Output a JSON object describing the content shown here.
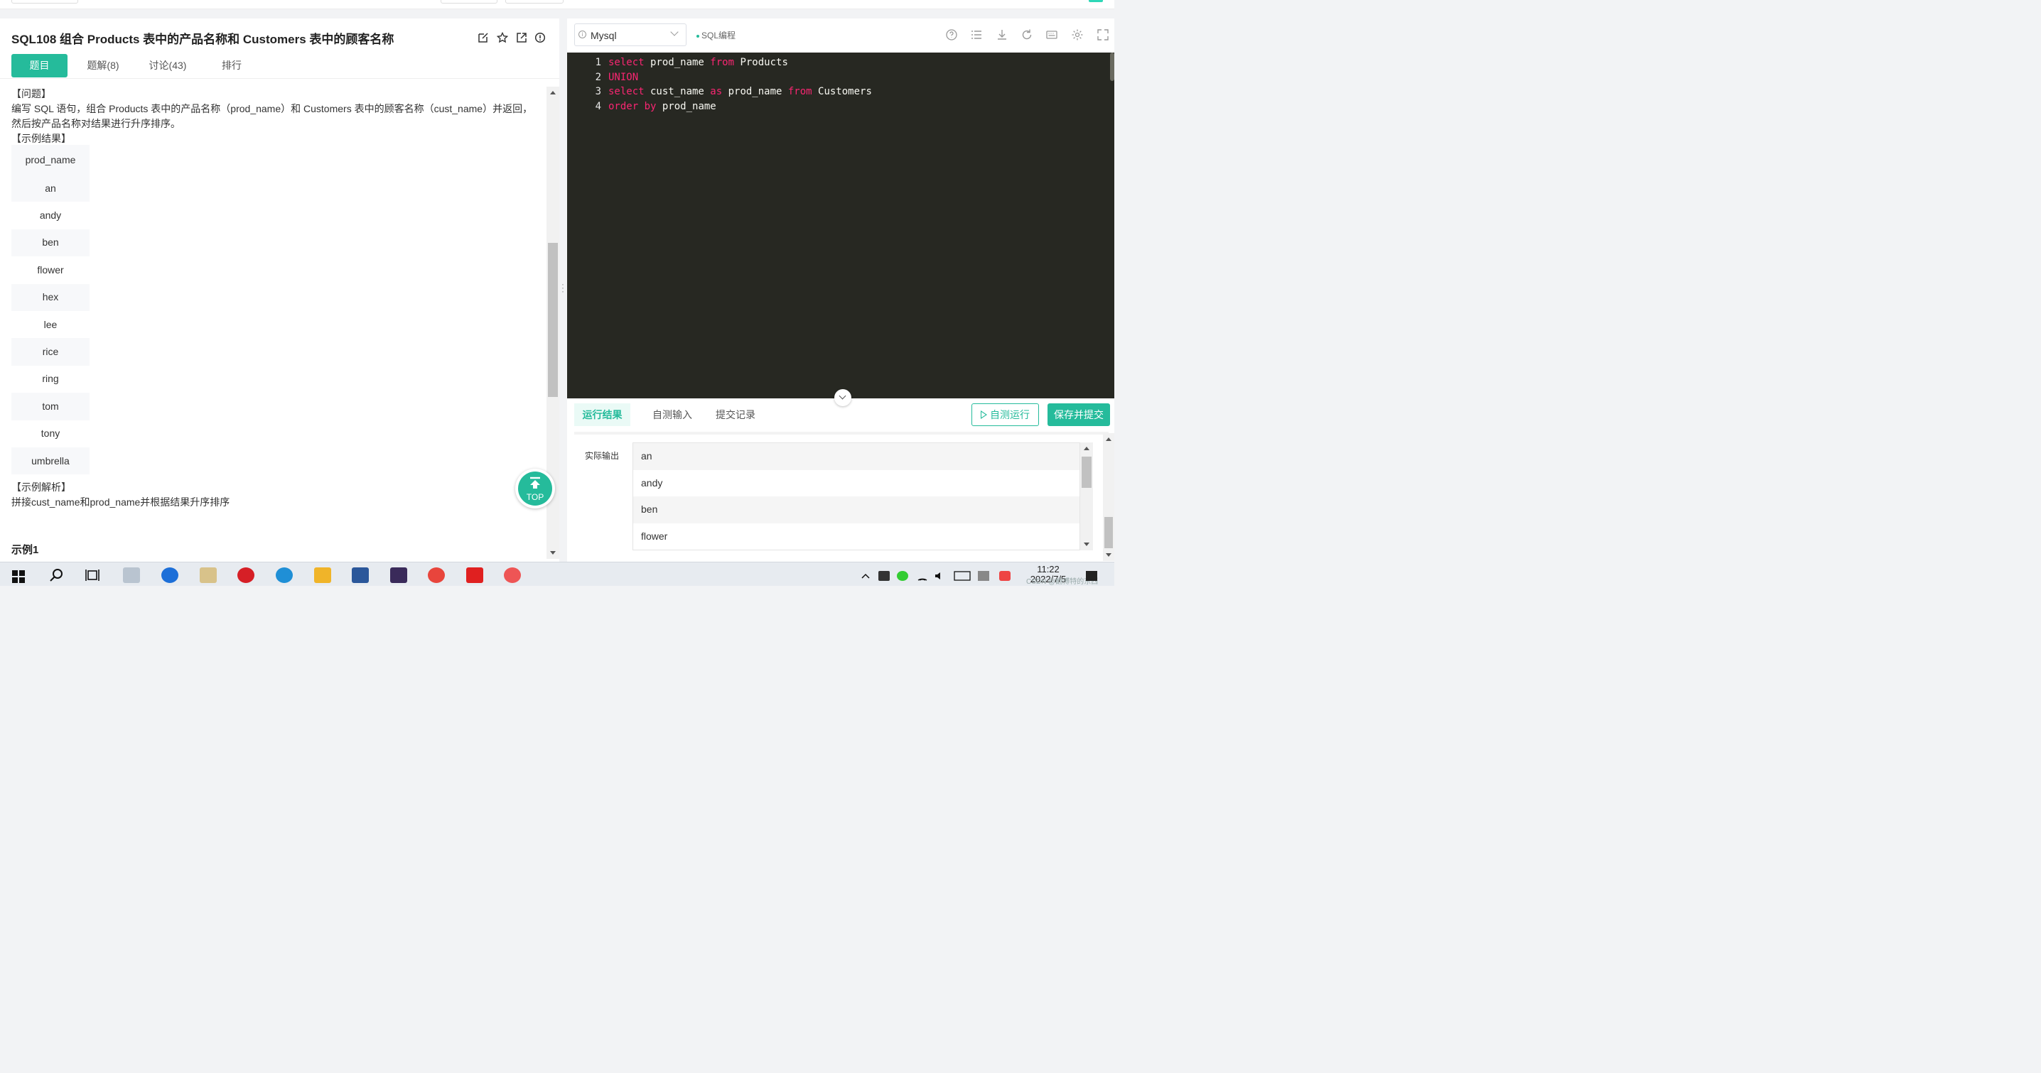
{
  "question": {
    "title": "SQL108  组合 Products 表中的产品名称和 Customers 表中的顾客名称",
    "tabs": [
      "题目",
      "题解(8)",
      "讨论(43)",
      "排行"
    ],
    "section_problem": "【问题】",
    "description": "编写 SQL 语句，组合 Products 表中的产品名称（prod_name）和 Customers 表中的顾客名称（cust_name）并返回，然后按产品名称对结果进行升序排序。",
    "section_example": "【示例结果】",
    "example_header": "prod_name",
    "example_rows": [
      "an",
      "andy",
      "ben",
      "flower",
      "hex",
      "lee",
      "rice",
      "ring",
      "tom",
      "tony",
      "umbrella"
    ],
    "section_analysis": "【示例解析】",
    "analysis": "拼接cust_name和prod_name并根据结果升序排序",
    "example1": "示例1",
    "top_button": "TOP"
  },
  "editor": {
    "language": "Mysql",
    "badge": "SQL编程",
    "lines": [
      [
        {
          "t": "select",
          "k": true
        },
        {
          "t": " prod_name ",
          "k": false
        },
        {
          "t": "from",
          "k": true
        },
        {
          "t": " Products",
          "k": false
        }
      ],
      [
        {
          "t": "UNION",
          "k": true
        }
      ],
      [
        {
          "t": "select",
          "k": true
        },
        {
          "t": " cust_name ",
          "k": false
        },
        {
          "t": "as",
          "k": true
        },
        {
          "t": " prod_name ",
          "k": false
        },
        {
          "t": "from",
          "k": true
        },
        {
          "t": " Customers",
          "k": false
        }
      ],
      [
        {
          "t": "order by",
          "k": true
        },
        {
          "t": " prod_name",
          "k": false
        }
      ]
    ]
  },
  "results": {
    "tabs": [
      "运行结果",
      "自测输入",
      "提交记录"
    ],
    "self_test": "自测运行",
    "submit": "保存并提交",
    "output_label": "实际输出",
    "output_rows": [
      "an",
      "andy",
      "ben",
      "flower"
    ]
  },
  "taskbar": {
    "time": "11:22",
    "date": "2022/7/5",
    "watermark": "CSDN @翻博特的东西"
  },
  "colors": {
    "accent": "#25bb9b",
    "editor_bg": "#272822",
    "keyword": "#f92672"
  }
}
